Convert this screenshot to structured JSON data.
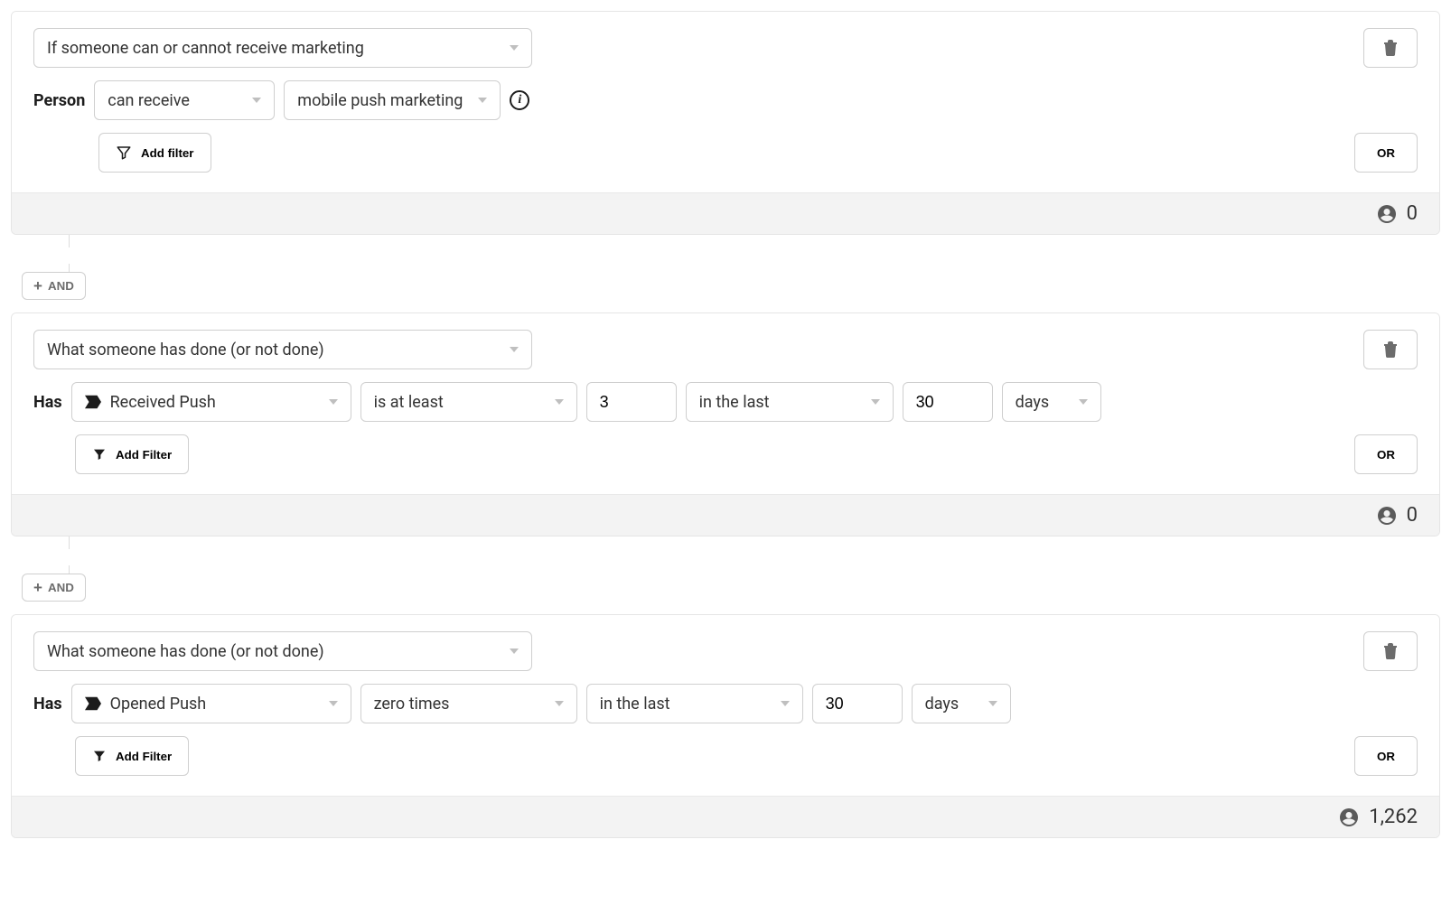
{
  "labels": {
    "person": "Person",
    "has": "Has",
    "or": "OR",
    "and": "AND",
    "add_filter_a": "Add filter",
    "add_filter_b": "Add Filter"
  },
  "blocks": [
    {
      "main_select": "If someone can or cannot receive marketing",
      "person_a": "can receive",
      "person_b": "mobile push marketing",
      "count": "0"
    },
    {
      "main_select": "What someone has done (or not done)",
      "event": "Received Push",
      "op": "is at least",
      "n": "3",
      "when": "in the last",
      "dur_n": "30",
      "dur_u": "days",
      "count": "0"
    },
    {
      "main_select": "What someone has done (or not done)",
      "event": "Opened Push",
      "op": "zero times",
      "when": "in the last",
      "dur_n": "30",
      "dur_u": "days",
      "count": "1,262"
    }
  ]
}
